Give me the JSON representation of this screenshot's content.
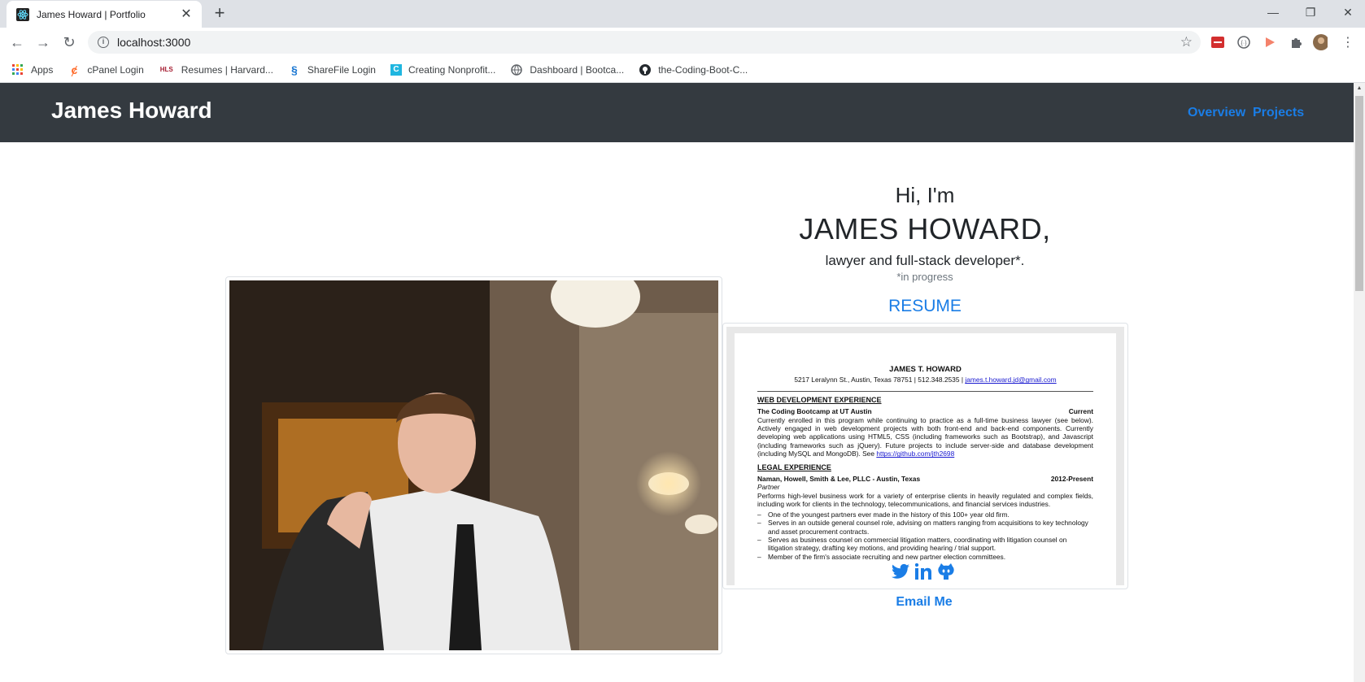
{
  "browser": {
    "tab_title": "James Howard | Portfolio",
    "url": "localhost:3000",
    "bookmarks": [
      {
        "label": "Apps"
      },
      {
        "label": "cPanel Login"
      },
      {
        "label": "Resumes | Harvard..."
      },
      {
        "label": "ShareFile Login"
      },
      {
        "label": "Creating Nonprofit..."
      },
      {
        "label": "Dashboard | Bootca..."
      },
      {
        "label": "the-Coding-Boot-C..."
      }
    ]
  },
  "page": {
    "brand": "James Howard",
    "nav": {
      "overview": "Overview",
      "projects": "Projects"
    },
    "greeting": "Hi, I'm",
    "name": "JAMES HOWARD,",
    "role": "lawyer and full-stack developer*.",
    "note": "*in progress",
    "resume_label": "RESUME",
    "email_label": "Email Me"
  },
  "resume": {
    "name": "JAMES T. HOWARD",
    "contact": "5217 Leralynn St., Austin, Texas 78751 | 512.348.2535 |",
    "email": "james.t.howard.jd@gmail.com",
    "section_web": "WEB DEVELOPMENT EXPERIENCE",
    "web_org": "The Coding Bootcamp at UT Austin",
    "web_date": "Current",
    "web_desc": "Currently enrolled in this program while continuing to practice as a full-time business lawyer (see below). Actively engaged in web development projects with both front-end and back-end components. Currently developing web applications using HTML5, CSS (including frameworks such as Bootstrap), and Javascript (including frameworks such as jQuery). Future projects to include server-side and database development (including MySQL and MongoDB). See",
    "web_link": "https://github.com/jth2698",
    "section_legal": "LEGAL EXPERIENCE",
    "legal_org": "Naman, Howell, Smith & Lee, PLLC - Austin, Texas",
    "legal_date": "2012-Present",
    "legal_title": "Partner",
    "legal_desc": "Performs high-level business work for a variety of enterprise clients in heavily regulated and complex fields, including work for clients in the technology, telecommunications, and financial services industries.",
    "bullets": [
      "One of the youngest partners ever made in the history of this 100+ year old firm.",
      "Serves in an outside general counsel role, advising on matters ranging from acquisitions to key technology and asset procurement contracts.",
      "Serves as business counsel on commercial litigation matters, coordinating with litigation counsel on litigation strategy, drafting key motions, and providing hearing / trial support.",
      "Member of the firm's associate recruiting and new partner election committees."
    ]
  },
  "icons": {
    "social": [
      "twitter-icon",
      "linkedin-icon",
      "github-icon"
    ],
    "accent": "#1a7de6",
    "navbar_bg": "#343a40"
  }
}
